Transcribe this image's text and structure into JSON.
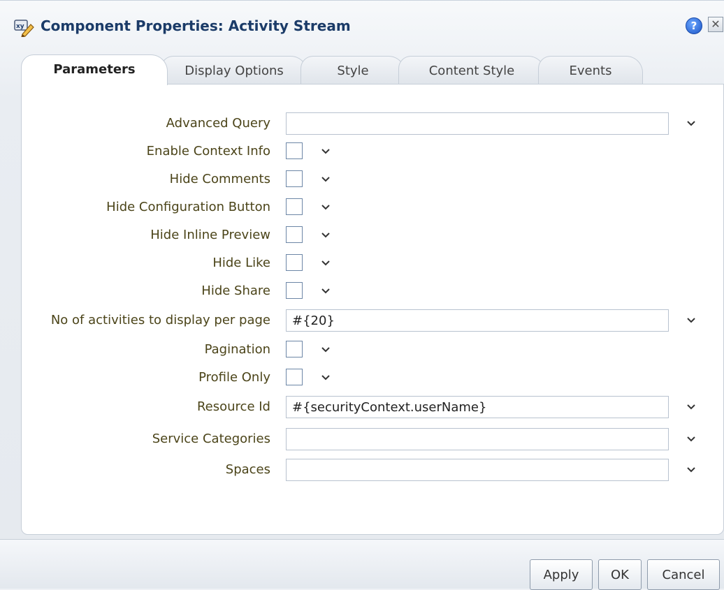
{
  "dialog": {
    "title": "Component Properties: Activity Stream",
    "help_icon": "help-icon",
    "close_icon": "close-icon",
    "help_glyph": "?",
    "close_glyph": "✕"
  },
  "tabs": [
    {
      "label": "Parameters",
      "active": true
    },
    {
      "label": "Display Options",
      "active": false
    },
    {
      "label": "Style",
      "active": false
    },
    {
      "label": "Content Style",
      "active": false
    },
    {
      "label": "Events",
      "active": false
    }
  ],
  "parameters": [
    {
      "label": "Advanced Query",
      "type": "text",
      "value": ""
    },
    {
      "label": "Enable Context Info",
      "type": "checkbox",
      "checked": false
    },
    {
      "label": "Hide Comments",
      "type": "checkbox",
      "checked": false
    },
    {
      "label": "Hide Configuration Button",
      "type": "checkbox",
      "checked": false
    },
    {
      "label": "Hide Inline Preview",
      "type": "checkbox",
      "checked": false
    },
    {
      "label": "Hide Like",
      "type": "checkbox",
      "checked": false
    },
    {
      "label": "Hide Share",
      "type": "checkbox",
      "checked": false
    },
    {
      "label": "No of activities to display per page",
      "type": "text",
      "value": "#{20}"
    },
    {
      "label": "Pagination",
      "type": "checkbox",
      "checked": false
    },
    {
      "label": "Profile Only",
      "type": "checkbox",
      "checked": false
    },
    {
      "label": "Resource Id",
      "type": "text",
      "value": "#{securityContext.userName}"
    },
    {
      "label": "Service Categories",
      "type": "text",
      "value": ""
    },
    {
      "label": "Spaces",
      "type": "text",
      "value": ""
    }
  ],
  "footer": {
    "apply_label": "Apply",
    "ok_label": "OK",
    "cancel_label": "Cancel"
  },
  "colors": {
    "title": "#1b3b68",
    "label": "#4b4419",
    "help": "#1c55c6"
  }
}
